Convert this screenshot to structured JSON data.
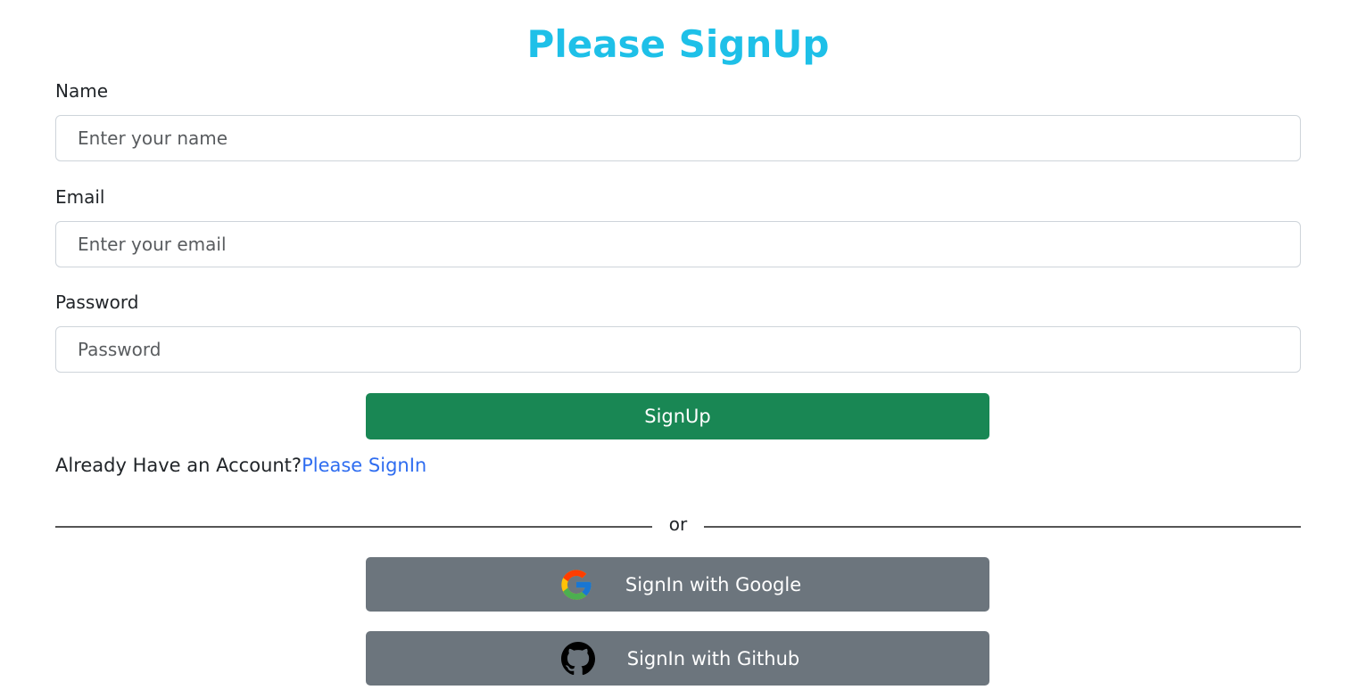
{
  "title": "Please SignUp",
  "form": {
    "name_label": "Name",
    "name_placeholder": "Enter your name",
    "email_label": "Email",
    "email_placeholder": "Enter your email",
    "password_label": "Password",
    "password_placeholder": "Password",
    "signup_button": "SignUp"
  },
  "account": {
    "prompt": "Already Have an Account?",
    "link": "Please SignIn"
  },
  "divider_text": "or",
  "social": {
    "google_label": "SignIn with Google",
    "google_icon": "google-icon",
    "github_label": "SignIn with Github",
    "github_icon": "github-icon"
  },
  "colors": {
    "title": "#1ec0e8",
    "signup_button": "#198754",
    "social_button": "#6c757d",
    "link": "#2f6df0"
  }
}
